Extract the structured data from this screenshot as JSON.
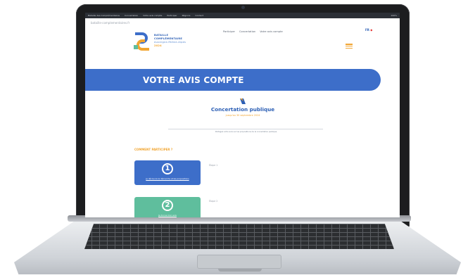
{
  "browser": {
    "tabs": [
      "Bataille des Complémentaires",
      "Concertation",
      "Votre avis compte",
      "Participer",
      "Régions",
      "Contact"
    ],
    "status": "100%",
    "address": "bataille-complementaires.fr"
  },
  "site": {
    "logo_line1": "BATAILLE",
    "logo_line2": "COMPLÉMENTAIRE",
    "logo_line3": "Auvergne-Rhône-Alpes",
    "logo_year": "2024",
    "nav": [
      "Participer",
      "Concertation",
      "Votre avis compte"
    ],
    "lang": "FR"
  },
  "banner": {
    "title": "VOTRE AVIS COMPTE"
  },
  "concertation": {
    "title": "Concertation publique",
    "subtitle": "jusqu'au 30 septembre 2024"
  },
  "intro": {
    "text": "Partagez votre avis sur les propositions de la concertation publique."
  },
  "steps": {
    "section_label": "COMMENT PARTICIPER ?",
    "items": [
      {
        "number": "1",
        "caption": "Je découvre la démarche et les propositions",
        "note": "Étape 1"
      },
      {
        "number": "2",
        "caption": "Je donne mon avis",
        "note": "Étape 2"
      }
    ]
  },
  "colors": {
    "brand_blue": "#3d6ec9",
    "accent_orange": "#f1a531",
    "step_green": "#5fbe9d",
    "laptop_frame": "#1c1d1f"
  }
}
